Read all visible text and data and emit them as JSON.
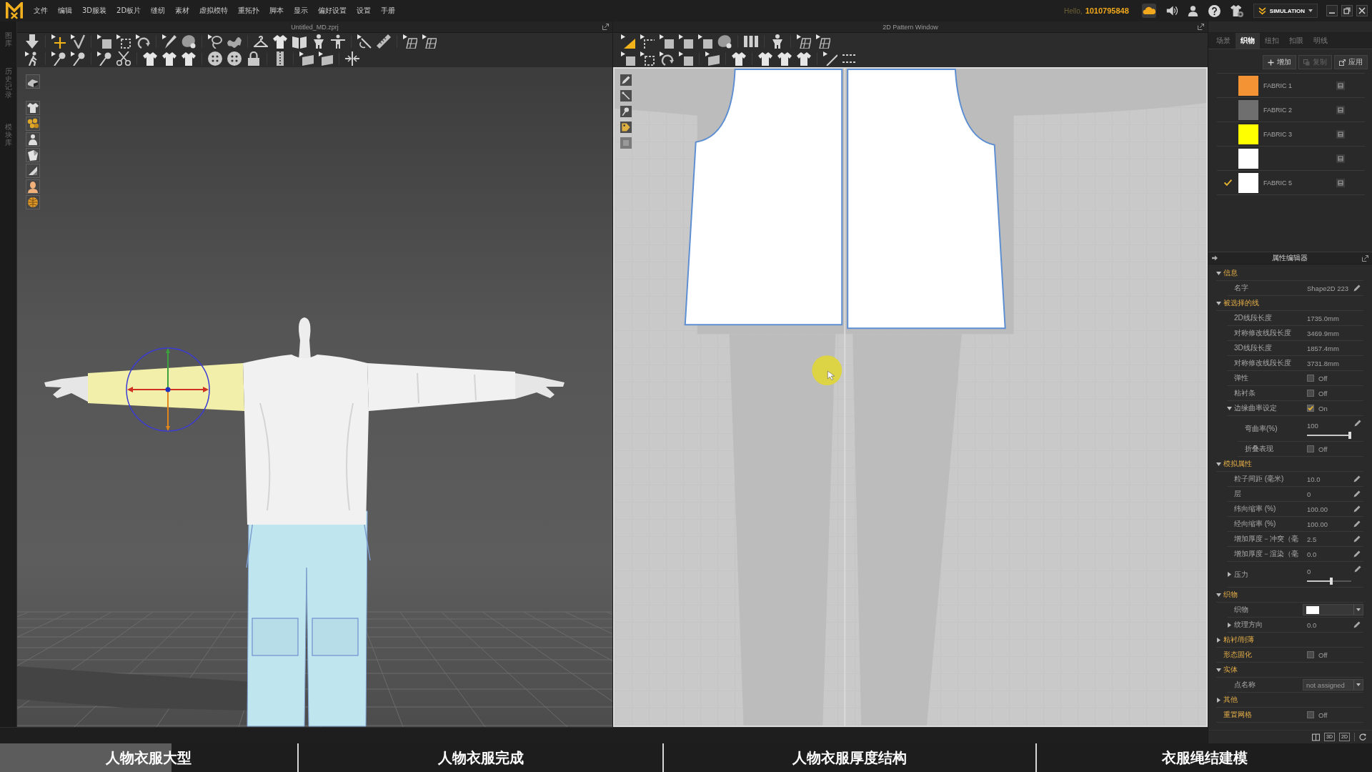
{
  "menu_bar": {
    "items": [
      "文件",
      "编辑",
      "3D服装",
      "2D板片",
      "缝纫",
      "素材",
      "虚拟模特",
      "重拓扑",
      "脚本",
      "显示",
      "偏好设置",
      "设置",
      "手册"
    ]
  },
  "account": {
    "greeting": "Hello,",
    "user_id": "1010795848"
  },
  "mode_switch": {
    "label": "SIMULATION"
  },
  "side_tabs": [
    {
      "label": "图库",
      "selected": false
    },
    {
      "label": "历史记录",
      "selected": false
    },
    {
      "label": "模块库",
      "selected": false
    }
  ],
  "window_3d": {
    "title": "Untitled_MD.zprj"
  },
  "window_2d": {
    "title": "2D Pattern Window"
  },
  "object_browser": {
    "tabs": [
      {
        "label": "场景",
        "selected": false
      },
      {
        "label": "织物",
        "selected": true
      },
      {
        "label": "纽扣",
        "selected": false
      },
      {
        "label": "扣眼",
        "selected": false
      },
      {
        "label": "明线",
        "selected": false
      }
    ],
    "actions": [
      {
        "kind": "add",
        "label": "增加",
        "disabled": false
      },
      {
        "kind": "copy",
        "label": "复制",
        "disabled": true
      },
      {
        "kind": "apply",
        "label": "应用",
        "disabled": false
      }
    ],
    "fabrics": [
      {
        "name": "FABRIC 1",
        "color": "#f39334",
        "selected": false
      },
      {
        "name": "FABRIC 2",
        "color": "#6f6f6f",
        "selected": false
      },
      {
        "name": "FABRIC 3",
        "color": "#ffff00",
        "selected": false
      },
      {
        "color": "#ffffff",
        "selected": false
      },
      {
        "name": "FABRIC 5",
        "color": "#ffffff",
        "selected": true
      }
    ]
  },
  "property_editor": {
    "title": "属性编辑器",
    "rows": [
      {
        "kind": "section",
        "label": "信息",
        "expanded": true,
        "children": [
          {
            "kind": "field",
            "label": "名字",
            "value": "Shape2D 223"
          }
        ]
      },
      {
        "kind": "section",
        "label": "被选择的线",
        "expanded": true,
        "children": [
          {
            "kind": "readout",
            "label": "2D线段长度",
            "value": "1735.0mm"
          },
          {
            "kind": "readout",
            "label": "对称修改线段长度",
            "value": "3469.9mm"
          },
          {
            "kind": "readout",
            "label": "3D线段长度",
            "value": "1857.4mm"
          },
          {
            "kind": "readout",
            "label": "对称修改线段长度",
            "value": "3731.8mm"
          },
          {
            "kind": "toggle",
            "label": "弹性",
            "on": false,
            "value": "Off"
          },
          {
            "kind": "toggle",
            "label": "粘衬条",
            "on": false,
            "value": "Off"
          },
          {
            "kind": "toggle",
            "label": "边缘曲率设定",
            "on": true,
            "value": "On",
            "expanded": true,
            "children": [
              {
                "kind": "slider",
                "label": "弯曲率(%)",
                "value": "100",
                "level": 1
              },
              {
                "kind": "toggle",
                "label": "折叠表现",
                "on": false,
                "value": "Off"
              }
            ]
          }
        ]
      },
      {
        "kind": "section",
        "label": "模拟属性",
        "expanded": true,
        "children": [
          {
            "kind": "field",
            "label": "粒子间距 (毫米)",
            "value": "10.0"
          },
          {
            "kind": "field",
            "label": "层",
            "value": "0"
          },
          {
            "kind": "field",
            "label": "纬向缩率 (%)",
            "value": "100.00"
          },
          {
            "kind": "field",
            "label": "经向缩率 (%)",
            "value": "100.00"
          },
          {
            "kind": "field",
            "label": "增加厚度－冲突（毫",
            "value": "2.5"
          },
          {
            "kind": "field",
            "label": "增加厚度－渲染（毫",
            "value": "0.0"
          },
          {
            "kind": "slider",
            "label": "压力",
            "value": "0",
            "level": 0.55,
            "expanded": false
          }
        ]
      },
      {
        "kind": "section",
        "label": "织物",
        "expanded": true,
        "children": [
          {
            "kind": "swatch",
            "label": "织物",
            "color": "#ffffff"
          },
          {
            "kind": "field",
            "label": "纹理方向",
            "value": "0.0",
            "expanded": false
          }
        ]
      },
      {
        "kind": "section",
        "label": "粘衬/削薄",
        "expanded": false
      },
      {
        "kind": "toggle",
        "label": "形态固化",
        "on": false,
        "value": "Off"
      },
      {
        "kind": "section",
        "label": "实体",
        "expanded": true,
        "children": [
          {
            "kind": "dropdown",
            "label": "点名称",
            "value": "not assigned"
          }
        ]
      },
      {
        "kind": "section",
        "label": "其他",
        "expanded": false
      },
      {
        "kind": "toggle",
        "label": "重置网格",
        "on": false,
        "value": "Off"
      }
    ]
  },
  "view_bar": {
    "buttons": [
      "3D",
      "2D"
    ]
  },
  "chapter_bar": {
    "level": 0.125,
    "chapters": [
      "人物衣服大型",
      "人物衣服完成",
      "人物衣服厚度结构",
      "衣服绳结建模"
    ]
  }
}
